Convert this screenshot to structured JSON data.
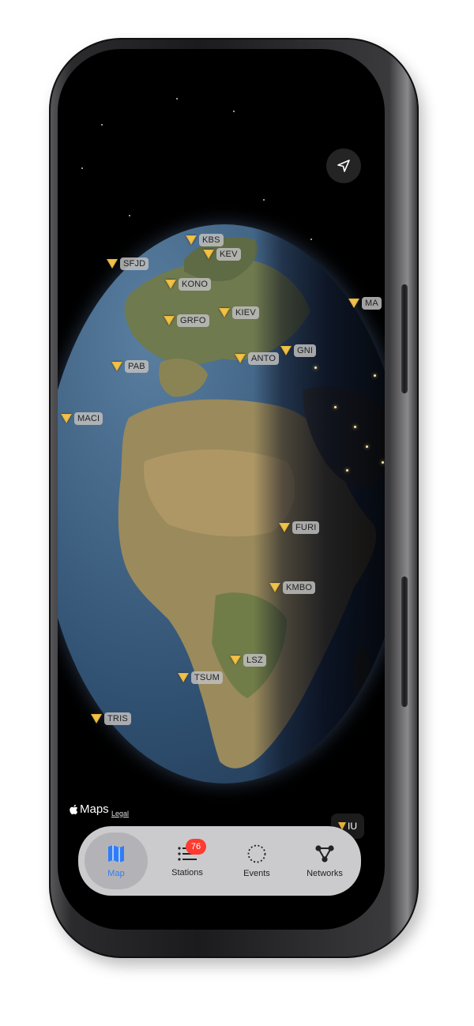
{
  "map": {
    "attribution_brand": "Maps",
    "legal_label": "Legal",
    "network_filter": "IU",
    "stations": [
      {
        "code": "KBS"
      },
      {
        "code": "KEV"
      },
      {
        "code": "SFJD"
      },
      {
        "code": "KONO"
      },
      {
        "code": "MA"
      },
      {
        "code": "GRFO"
      },
      {
        "code": "KIEV"
      },
      {
        "code": "ANTO"
      },
      {
        "code": "GNI"
      },
      {
        "code": "PAB"
      },
      {
        "code": "MACI"
      },
      {
        "code": "FURI"
      },
      {
        "code": "KMBO"
      },
      {
        "code": "LSZ"
      },
      {
        "code": "TSUM"
      },
      {
        "code": "TRIS"
      }
    ]
  },
  "tabbar": {
    "tabs": [
      {
        "label": "Map",
        "icon": "map-icon",
        "active": true
      },
      {
        "label": "Stations",
        "icon": "list-icon",
        "badge": "76"
      },
      {
        "label": "Events",
        "icon": "dotted-circle-icon"
      },
      {
        "label": "Networks",
        "icon": "network-icon"
      }
    ]
  },
  "colors": {
    "accent": "#2f7df6",
    "station_marker": "#e6b33a",
    "badge": "#ff3b30"
  }
}
